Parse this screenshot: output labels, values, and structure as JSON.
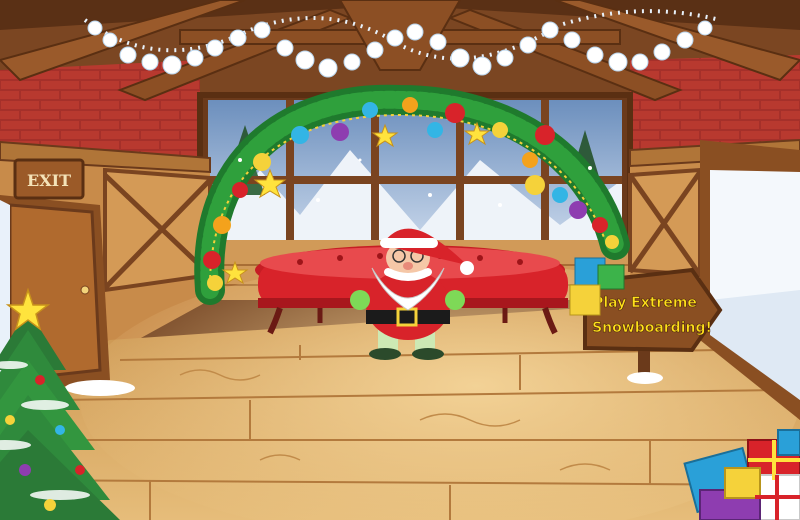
{
  "scene": {
    "exit_label": "EXIT",
    "play_sign_line1": "Play Extreme",
    "play_sign_line2": "Snowboarding!"
  },
  "colors": {
    "floor": "#e2b66e",
    "wood_dark": "#7a4420",
    "brick": "#a5302a",
    "couch": "#d8232a",
    "sign_text": "#ffe11a"
  },
  "icons": [
    "snowflake-garland",
    "christmas-tree",
    "presents-pile",
    "ornament-arch",
    "santa-character"
  ]
}
